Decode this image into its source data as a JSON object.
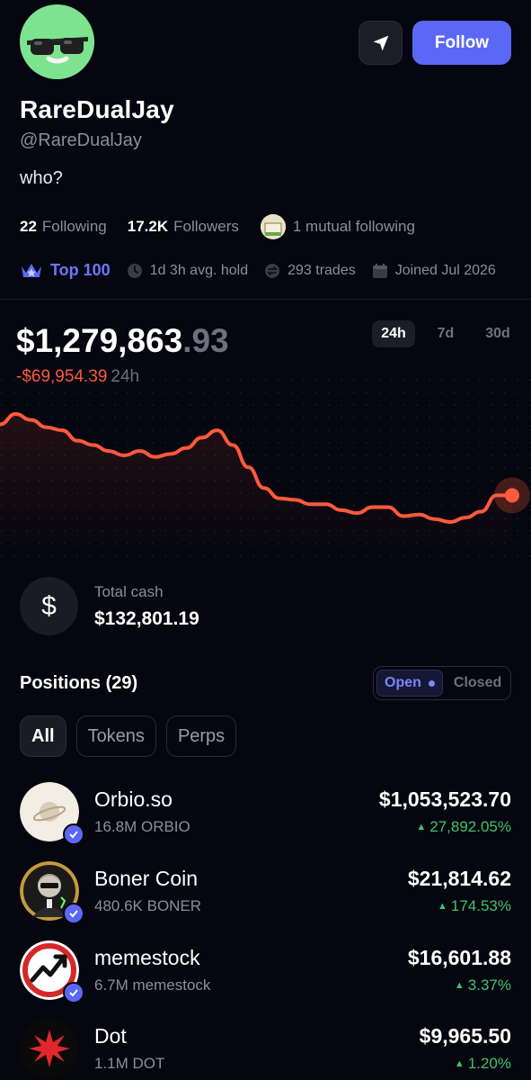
{
  "profile": {
    "display_name": "RareDualJay",
    "handle": "@RareDualJay",
    "bio": "who?",
    "follow_label": "Follow",
    "following_count": "22",
    "following_label": "Following",
    "followers_count": "17.2K",
    "followers_label": "Followers",
    "mutual_text": "1 mutual following",
    "rank_label": "Top 100",
    "avg_hold": "1d 3h avg. hold",
    "trades": "293 trades",
    "joined": "Joined Jul 2026"
  },
  "portfolio": {
    "balance_main": "$1,279,863",
    "balance_cents": ".93",
    "change_value": "-$69,954.39",
    "change_period": "24h",
    "ranges": [
      "24h",
      "7d",
      "30d"
    ],
    "active_range": "24h",
    "line_color": "#ff5a3c"
  },
  "chart_data": {
    "type": "line",
    "title": "",
    "xlabel": "",
    "ylabel": "",
    "series": [
      {
        "values": [
          1338000,
          1345000,
          1341000,
          1336000,
          1334000,
          1327000,
          1324000,
          1320000,
          1317000,
          1320000,
          1316000,
          1318000,
          1322000,
          1329000,
          1334000,
          1324000,
          1309000,
          1295000,
          1288000,
          1287000,
          1284000,
          1284000,
          1280000,
          1278000,
          1282000,
          1282000,
          1276000,
          1277000,
          1274000,
          1272000,
          1275000,
          1279000,
          1290000,
          1290000
        ]
      }
    ]
  },
  "cash": {
    "label": "Total cash",
    "value": "$132,801.19",
    "symbol": "$"
  },
  "positions": {
    "title": "Positions (29)",
    "toggle_open": "Open",
    "toggle_closed": "Closed",
    "filters": [
      "All",
      "Tokens",
      "Perps"
    ],
    "items": [
      {
        "name": "Orbio.so",
        "amount": "16.8M ORBIO",
        "value": "$1,053,523.70",
        "change": "27,892.05%",
        "icon": "planet-icon"
      },
      {
        "name": "Boner Coin",
        "amount": "480.6K BONER",
        "value": "$21,814.62",
        "change": "174.53%",
        "icon": "statue-icon"
      },
      {
        "name": "memestock",
        "amount": "6.7M memestock",
        "value": "$16,601.88",
        "change": "3.37%",
        "icon": "chart-arrow-icon"
      },
      {
        "name": "Dot",
        "amount": "1.1M DOT",
        "value": "$9,965.50",
        "change": "1.20%",
        "icon": "burst-icon"
      }
    ]
  }
}
